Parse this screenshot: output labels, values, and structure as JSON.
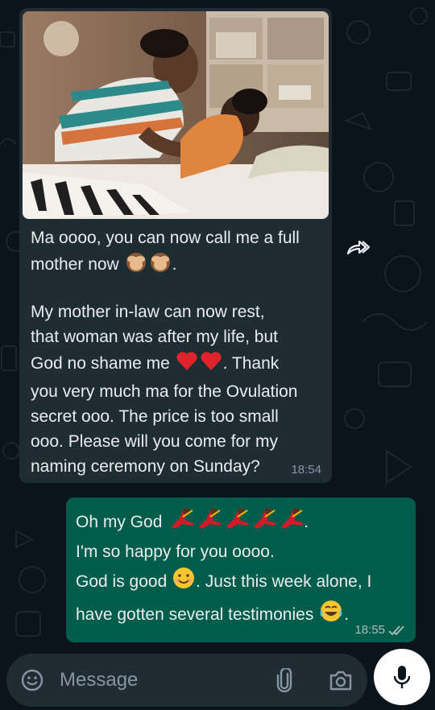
{
  "incoming_message": {
    "line1": "Ma oooo, you can now call me a full",
    "line2": "mother now",
    "line2_end": ".",
    "para2_line1": "My mother in-law can now rest,",
    "para2_line2": "that woman was after my life, but",
    "para2_line3": "God no shame me",
    "para2_line3_end": ". Thank",
    "para2_line4": "you very much ma for the Ovulation",
    "para2_line5": "secret ooo. The price is too small",
    "para2_line6": "ooo. Please will you come for my",
    "para2_line7": "naming ceremony on Sunday?",
    "time": "18:54"
  },
  "outgoing_message": {
    "line1": "Oh my God",
    "line1_end": ".",
    "line2": "I'm so happy for you oooo.",
    "line3_start": "God is good",
    "line3_end": ". Just this week alone, I",
    "line4": "have gotten several testimonies",
    "line4_end": ".",
    "time": "18:55",
    "status": "read"
  },
  "composer": {
    "placeholder": "Message"
  },
  "icons": {
    "forward": "forward-icon",
    "emoji": "emoji-icon",
    "attach": "paperclip-icon",
    "camera": "camera-icon",
    "mic": "microphone-icon",
    "read_receipt": "double-check-icon"
  },
  "colors": {
    "background": "#0b141a",
    "incoming_bubble": "#1f2c33",
    "outgoing_bubble": "#005c4b",
    "text": "#e9edef",
    "meta": "#8696a0"
  }
}
